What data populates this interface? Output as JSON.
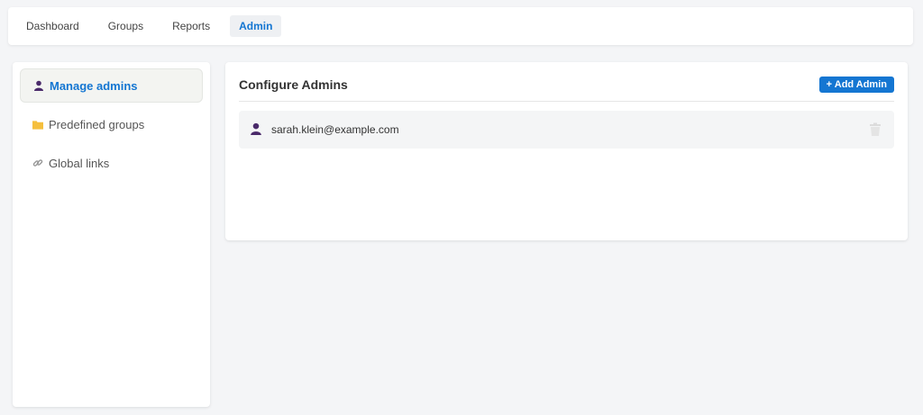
{
  "topnav": {
    "tabs": [
      {
        "label": "Dashboard"
      },
      {
        "label": "Groups"
      },
      {
        "label": "Reports"
      },
      {
        "label": "Admin",
        "active": true
      }
    ]
  },
  "sidebar": {
    "items": [
      {
        "label": "Manage admins",
        "icon": "user-icon",
        "active": true
      },
      {
        "label": "Predefined groups",
        "icon": "folder-icon"
      },
      {
        "label": "Global links",
        "icon": "link-icon"
      }
    ]
  },
  "panel": {
    "title": "Configure Admins",
    "add_button_label": "+ Add Admin",
    "admins": [
      {
        "email": "sarah.klein@example.com"
      }
    ]
  },
  "colors": {
    "accent": "#1476d2",
    "user_icon": "#4a2a6a",
    "folder_icon": "#f5bf3d"
  }
}
